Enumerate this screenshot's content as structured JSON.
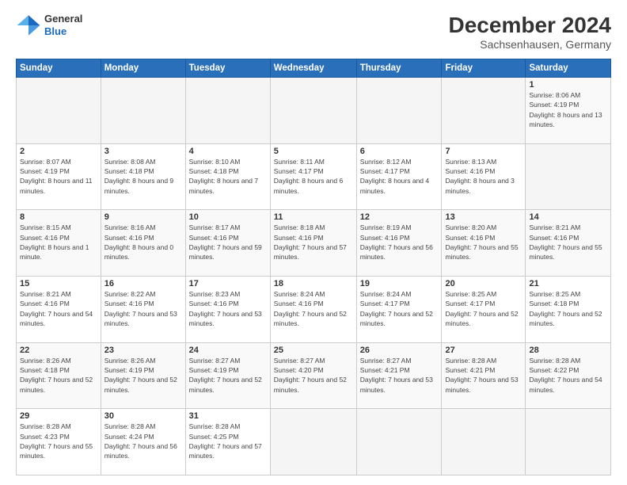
{
  "header": {
    "title": "December 2024",
    "subtitle": "Sachsenhausen, Germany",
    "logo_general": "General",
    "logo_blue": "Blue"
  },
  "calendar": {
    "days_of_week": [
      "Sunday",
      "Monday",
      "Tuesday",
      "Wednesday",
      "Thursday",
      "Friday",
      "Saturday"
    ],
    "weeks": [
      [
        null,
        null,
        null,
        null,
        null,
        null,
        {
          "day": "1",
          "sunrise": "8:06 AM",
          "sunset": "4:19 PM",
          "daylight": "8 hours and 13 minutes."
        }
      ],
      [
        {
          "day": "2",
          "sunrise": "8:07 AM",
          "sunset": "4:19 PM",
          "daylight": "8 hours and 11 minutes."
        },
        {
          "day": "3",
          "sunrise": "8:08 AM",
          "sunset": "4:18 PM",
          "daylight": "8 hours and 9 minutes."
        },
        {
          "day": "4",
          "sunrise": "8:10 AM",
          "sunset": "4:18 PM",
          "daylight": "8 hours and 7 minutes."
        },
        {
          "day": "5",
          "sunrise": "8:11 AM",
          "sunset": "4:17 PM",
          "daylight": "8 hours and 6 minutes."
        },
        {
          "day": "6",
          "sunrise": "8:12 AM",
          "sunset": "4:17 PM",
          "daylight": "8 hours and 4 minutes."
        },
        {
          "day": "7",
          "sunrise": "8:13 AM",
          "sunset": "4:16 PM",
          "daylight": "8 hours and 3 minutes."
        }
      ],
      [
        {
          "day": "8",
          "sunrise": "8:15 AM",
          "sunset": "4:16 PM",
          "daylight": "8 hours and 1 minute."
        },
        {
          "day": "9",
          "sunrise": "8:16 AM",
          "sunset": "4:16 PM",
          "daylight": "8 hours and 0 minutes."
        },
        {
          "day": "10",
          "sunrise": "8:17 AM",
          "sunset": "4:16 PM",
          "daylight": "7 hours and 59 minutes."
        },
        {
          "day": "11",
          "sunrise": "8:18 AM",
          "sunset": "4:16 PM",
          "daylight": "7 hours and 57 minutes."
        },
        {
          "day": "12",
          "sunrise": "8:19 AM",
          "sunset": "4:16 PM",
          "daylight": "7 hours and 56 minutes."
        },
        {
          "day": "13",
          "sunrise": "8:20 AM",
          "sunset": "4:16 PM",
          "daylight": "7 hours and 55 minutes."
        },
        {
          "day": "14",
          "sunrise": "8:21 AM",
          "sunset": "4:16 PM",
          "daylight": "7 hours and 55 minutes."
        }
      ],
      [
        {
          "day": "15",
          "sunrise": "8:21 AM",
          "sunset": "4:16 PM",
          "daylight": "7 hours and 54 minutes."
        },
        {
          "day": "16",
          "sunrise": "8:22 AM",
          "sunset": "4:16 PM",
          "daylight": "7 hours and 53 minutes."
        },
        {
          "day": "17",
          "sunrise": "8:23 AM",
          "sunset": "4:16 PM",
          "daylight": "7 hours and 53 minutes."
        },
        {
          "day": "18",
          "sunrise": "8:24 AM",
          "sunset": "4:16 PM",
          "daylight": "7 hours and 52 minutes."
        },
        {
          "day": "19",
          "sunrise": "8:24 AM",
          "sunset": "4:17 PM",
          "daylight": "7 hours and 52 minutes."
        },
        {
          "day": "20",
          "sunrise": "8:25 AM",
          "sunset": "4:17 PM",
          "daylight": "7 hours and 52 minutes."
        },
        {
          "day": "21",
          "sunrise": "8:25 AM",
          "sunset": "4:18 PM",
          "daylight": "7 hours and 52 minutes."
        }
      ],
      [
        {
          "day": "22",
          "sunrise": "8:26 AM",
          "sunset": "4:18 PM",
          "daylight": "7 hours and 52 minutes."
        },
        {
          "day": "23",
          "sunrise": "8:26 AM",
          "sunset": "4:19 PM",
          "daylight": "7 hours and 52 minutes."
        },
        {
          "day": "24",
          "sunrise": "8:27 AM",
          "sunset": "4:19 PM",
          "daylight": "7 hours and 52 minutes."
        },
        {
          "day": "25",
          "sunrise": "8:27 AM",
          "sunset": "4:20 PM",
          "daylight": "7 hours and 52 minutes."
        },
        {
          "day": "26",
          "sunrise": "8:27 AM",
          "sunset": "4:21 PM",
          "daylight": "7 hours and 53 minutes."
        },
        {
          "day": "27",
          "sunrise": "8:28 AM",
          "sunset": "4:21 PM",
          "daylight": "7 hours and 53 minutes."
        },
        {
          "day": "28",
          "sunrise": "8:28 AM",
          "sunset": "4:22 PM",
          "daylight": "7 hours and 54 minutes."
        }
      ],
      [
        {
          "day": "29",
          "sunrise": "8:28 AM",
          "sunset": "4:23 PM",
          "daylight": "7 hours and 55 minutes."
        },
        {
          "day": "30",
          "sunrise": "8:28 AM",
          "sunset": "4:24 PM",
          "daylight": "7 hours and 56 minutes."
        },
        {
          "day": "31",
          "sunrise": "8:28 AM",
          "sunset": "4:25 PM",
          "daylight": "7 hours and 57 minutes."
        },
        null,
        null,
        null,
        null
      ]
    ]
  }
}
